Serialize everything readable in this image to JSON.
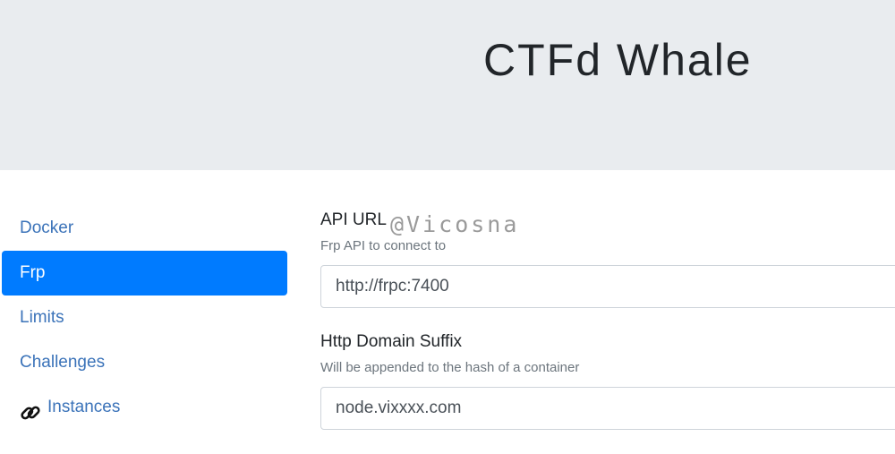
{
  "header": {
    "title": "CTFd Whale"
  },
  "sidebar": {
    "items": [
      {
        "label": "Docker",
        "active": false
      },
      {
        "label": "Frp",
        "active": true
      },
      {
        "label": "Limits",
        "active": false
      },
      {
        "label": "Challenges",
        "active": false
      },
      {
        "label": "Instances",
        "active": false,
        "icon": "chain-link-icon"
      }
    ]
  },
  "form": {
    "api_url": {
      "label": "API URL",
      "help": "Frp API to connect to",
      "value": "http://frpc:7400"
    },
    "http_domain_suffix": {
      "label": "Http Domain Suffix",
      "help": "Will be appended to the hash of a container",
      "value": "node.vixxxx.com"
    }
  },
  "watermark": "@Vicosna",
  "colors": {
    "header_bg": "#e9ecef",
    "active_bg": "#007bff",
    "link": "#3b73b9"
  }
}
